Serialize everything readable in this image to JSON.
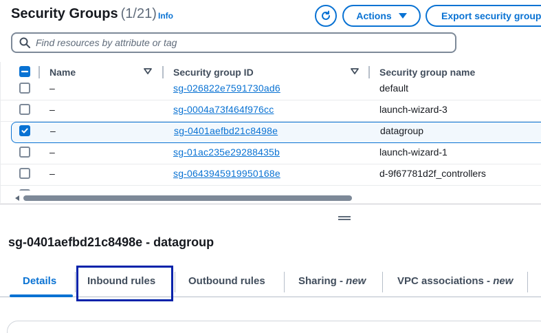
{
  "header": {
    "title": "Security Groups",
    "count": "(1/21)",
    "info_label": "Info",
    "refresh_icon": "refresh-icon",
    "actions_label": "Actions",
    "export_label": "Export security groups"
  },
  "search": {
    "placeholder": "Find resources by attribute or tag"
  },
  "table": {
    "columns": [
      "Name",
      "Security group ID",
      "Security group name"
    ],
    "rows": [
      {
        "name": "–",
        "id": "sg-026822e7591730ad6",
        "group_name": "default",
        "selected": false
      },
      {
        "name": "–",
        "id": "sg-0004a73f464f976cc",
        "group_name": "launch-wizard-3",
        "selected": false
      },
      {
        "name": "–",
        "id": "sg-0401aefbd21c8498e",
        "group_name": "datagroup",
        "selected": true
      },
      {
        "name": "–",
        "id": "sg-01ac235e29288435b",
        "group_name": "launch-wizard-1",
        "selected": false
      },
      {
        "name": "–",
        "id": "sg-0643945919950168e",
        "group_name": "d-9f67781d2f_controllers",
        "selected": false
      }
    ]
  },
  "details": {
    "title": "sg-0401aefbd21c8498e - datagroup",
    "tabs": [
      {
        "label": "Details",
        "suffix": ""
      },
      {
        "label": "Inbound rules",
        "suffix": ""
      },
      {
        "label": "Outbound rules",
        "suffix": ""
      },
      {
        "label": "Sharing - ",
        "suffix": "new"
      },
      {
        "label": "VPC associations - ",
        "suffix": "new"
      }
    ]
  },
  "colors": {
    "accent": "#0972d3",
    "highlight_box": "#0022aa"
  }
}
